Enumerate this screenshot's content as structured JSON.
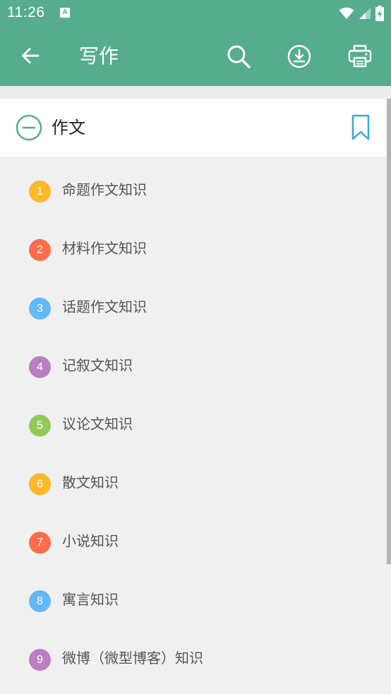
{
  "status_bar": {
    "time": "11:26",
    "notification_letter": "A"
  },
  "app_bar": {
    "title": "写作",
    "icons": [
      "back-arrow-icon",
      "search-icon",
      "download-icon",
      "print-icon"
    ]
  },
  "section": {
    "title": "作文",
    "icons": [
      "collapse-minus-icon",
      "bookmark-icon"
    ]
  },
  "list": {
    "items": [
      {
        "number": "1",
        "label": "命题作文知识",
        "color": "#fbb829"
      },
      {
        "number": "2",
        "label": "材料作文知识",
        "color": "#fc6b4a"
      },
      {
        "number": "3",
        "label": "话题作文知识",
        "color": "#64b8f8"
      },
      {
        "number": "4",
        "label": "记叙文知识",
        "color": "#b97fc1"
      },
      {
        "number": "5",
        "label": "议论文知识",
        "color": "#93c95a"
      },
      {
        "number": "6",
        "label": "散文知识",
        "color": "#fbb829"
      },
      {
        "number": "7",
        "label": "小说知识",
        "color": "#fc6b4a"
      },
      {
        "number": "8",
        "label": "寓言知识",
        "color": "#64b8f8"
      },
      {
        "number": "9",
        "label": "微博（微型博客）知识",
        "color": "#b97fc1"
      }
    ]
  },
  "colors": {
    "primary": "#55ad8e",
    "background": "#f0f0f0",
    "bookmark": "#3aa8d8"
  }
}
